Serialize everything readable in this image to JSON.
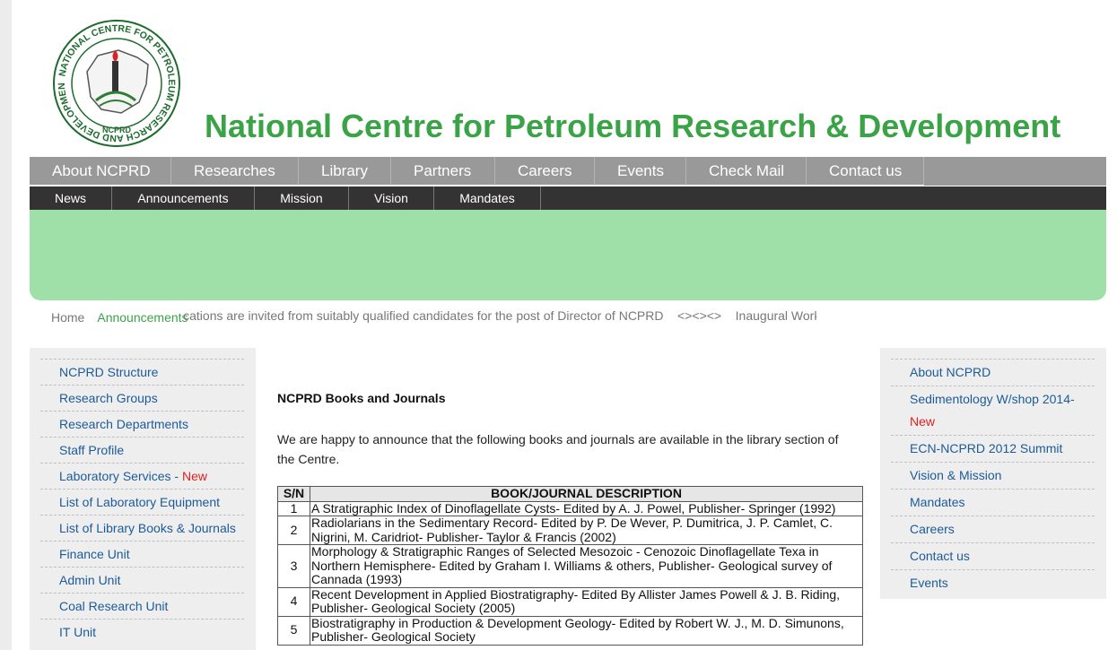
{
  "header": {
    "logo_ring_text": "NATIONAL CENTRE FOR PETROLEUM RESEARCH AND DEVELOPMENT",
    "logo_short": "NCPRD",
    "title": "National Centre for Petroleum Research & Development"
  },
  "main_nav": [
    "About NCPRD",
    "Researches",
    "Library",
    "Partners",
    "Careers",
    "Events",
    "Check Mail",
    "Contact us"
  ],
  "sub_nav": [
    "News",
    "Announcements",
    "Mission",
    "Vision",
    "Mandates"
  ],
  "breadcrumb": {
    "home": "Home",
    "announcements": "Announcements",
    "ticker": "Applications are invited from suitably qualified candidates for the post of Director of NCPRD    <><><>    Inaugural Workshop"
  },
  "left_sidebar": [
    {
      "label": "NCPRD Structure"
    },
    {
      "label": "Research Groups"
    },
    {
      "label": "Research Departments"
    },
    {
      "label": "Staff Profile"
    },
    {
      "label": "Laboratory Services - ",
      "new": "New"
    },
    {
      "label": "List of Laboratory Equipment"
    },
    {
      "label": "List of Library Books & Journals"
    },
    {
      "label": "Finance Unit"
    },
    {
      "label": "Admin Unit"
    },
    {
      "label": "Coal Research Unit"
    },
    {
      "label": "IT Unit"
    }
  ],
  "right_sidebar": [
    {
      "label": "About NCPRD"
    },
    {
      "label": "Sedimentology W/shop 2014-",
      "new": "New"
    },
    {
      "label": "ECN-NCPRD 2012 Summit"
    },
    {
      "label": "Vision & Mission"
    },
    {
      "label": "Mandates"
    },
    {
      "label": "Careers"
    },
    {
      "label": "Contact us"
    },
    {
      "label": "Events"
    }
  ],
  "content": {
    "title": "NCPRD Books and Journals",
    "intro": "We are happy to announce that the following books and journals are available in the library section of the Centre."
  },
  "books_table": {
    "headers": [
      "S/N",
      "BOOK/JOURNAL DESCRIPTION"
    ],
    "rows": [
      [
        "1",
        "A Stratigraphic Index of Dinoflagellate Cysts- Edited by A. J. Powel, Publisher- Springer (1992)"
      ],
      [
        "2",
        "Radiolarians in the Sedimentary Record- Edited by P. De Wever, P. Dumitrica, J. P. Camlet, C. Nigrini, M. Caridriot- Publisher- Taylor & Francis (2002)"
      ],
      [
        "3",
        "Morphology & Stratigraphic Ranges of Selected Mesozoic - Cenozoic Dinoflagellate Texa in Northern Hemisphere- Edited by Graham I. Williams & others, Publisher- Geological survey of Cannada (1993)"
      ],
      [
        "4",
        "Recent Development in Applied Biostratigraphy- Edited By Allister James Powell & J. B. Riding, Publisher- Geological Society (2005)"
      ],
      [
        "5",
        "Biostratigraphy in Production & Development Geology- Edited by Robert W. J., M. D. Simunons, Publisher- Geological Society"
      ]
    ]
  },
  "colors": {
    "title_green": "#3aa346",
    "main_nav_bg": "#999999",
    "sub_nav_bg": "#333333",
    "banner_bg": "#9fe0a8",
    "link_blue": "#1c5b99",
    "new_red": "#e02020"
  }
}
